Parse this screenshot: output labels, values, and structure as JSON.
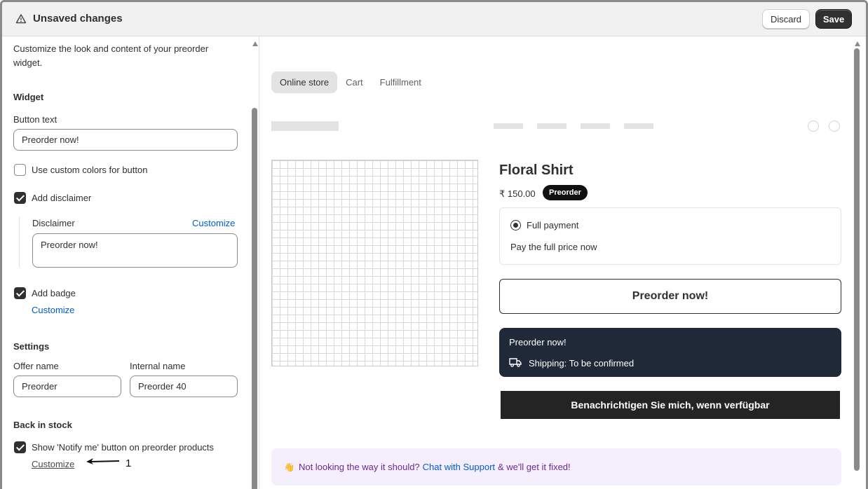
{
  "topbar": {
    "title": "Unsaved changes",
    "icon": "warning-icon",
    "discard_label": "Discard",
    "save_label": "Save"
  },
  "sidebar": {
    "intro": "Customize the look and content of your preorder widget.",
    "widget_heading": "Widget",
    "button_text_label": "Button text",
    "button_text_value": "Preorder now!",
    "custom_colors_label": "Use custom colors for button",
    "custom_colors_checked": false,
    "disclaimer_checkbox_label": "Add disclaimer",
    "disclaimer_checked": true,
    "disclaimer_label": "Disclaimer",
    "disclaimer_customize": "Customize",
    "disclaimer_value": "Preorder now!",
    "badge_label": "Add badge",
    "badge_checked": true,
    "badge_customize": "Customize",
    "settings_heading": "Settings",
    "offer_name_label": "Offer name",
    "offer_name_value": "Preorder",
    "internal_name_label": "Internal name",
    "internal_name_value": "Preorder 40",
    "back_in_stock_heading": "Back in stock",
    "notify_label": "Show 'Notify me' button on preorder products",
    "notify_checked": true,
    "notify_customize": "Customize",
    "annotation_number": "1"
  },
  "preview": {
    "tabs": [
      "Online store",
      "Cart",
      "Fulfillment"
    ],
    "active_tab": "Online store",
    "product_title": "Floral Shirt",
    "price": "₹ 150.00",
    "badge": "Preorder",
    "payment_option": "Full payment",
    "payment_desc": "Pay the full price now",
    "preorder_button": "Preorder now!",
    "disclaimer_text": "Preorder now!",
    "shipping_text": "Shipping: To be confirmed",
    "notify_button": "Benachrichtigen Sie mich, wenn verfügbar",
    "support_prefix": "Not looking the way it should?",
    "support_link": "Chat with Support",
    "support_suffix": "& we'll get it fixed!"
  },
  "colors": {
    "accent_link": "#005bd3",
    "save_button": "#303030",
    "shipping_box": "#1f2937",
    "support_bg": "#f5eefc"
  }
}
